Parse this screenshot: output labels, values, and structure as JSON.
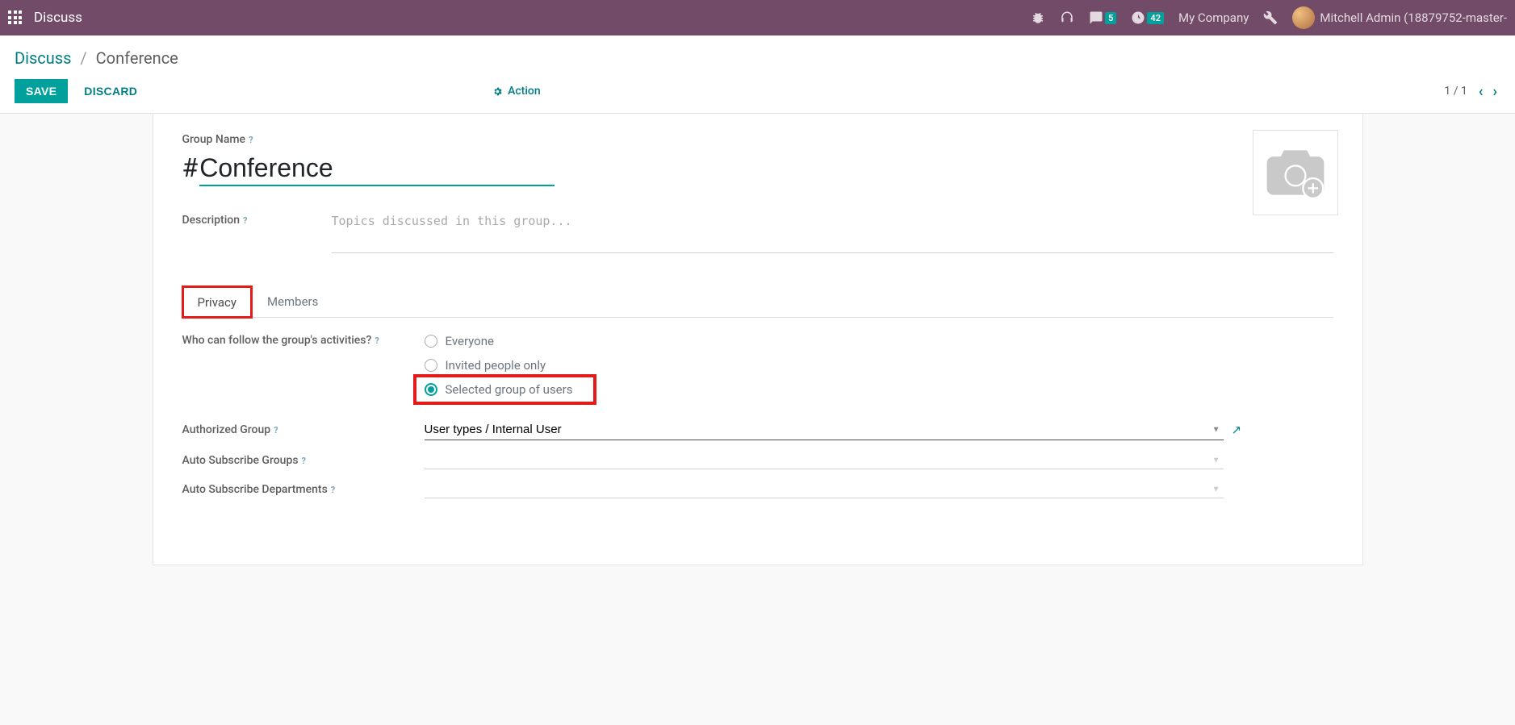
{
  "navbar": {
    "app_title": "Discuss",
    "messages_count": "5",
    "activities_count": "42",
    "company": "My Company",
    "user": "Mitchell Admin (18879752-master-"
  },
  "breadcrumb": {
    "root": "Discuss",
    "current": "Conference"
  },
  "buttons": {
    "save": "SAVE",
    "discard": "DISCARD",
    "action": "Action"
  },
  "pager": {
    "text": "1 / 1"
  },
  "form": {
    "group_name_label": "Group Name",
    "group_name_prefix": "#",
    "group_name_value": "Conference",
    "description_label": "Description",
    "description_placeholder": "Topics discussed in this group..."
  },
  "tabs": {
    "privacy": "Privacy",
    "members": "Members"
  },
  "privacy": {
    "question": "Who can follow the group's activities?",
    "options": {
      "everyone": "Everyone",
      "invited": "Invited people only",
      "selected": "Selected group of users"
    },
    "authorized_group_label": "Authorized Group",
    "authorized_group_value": "User types / Internal User",
    "auto_subscribe_groups_label": "Auto Subscribe Groups",
    "auto_subscribe_departments_label": "Auto Subscribe Departments"
  }
}
